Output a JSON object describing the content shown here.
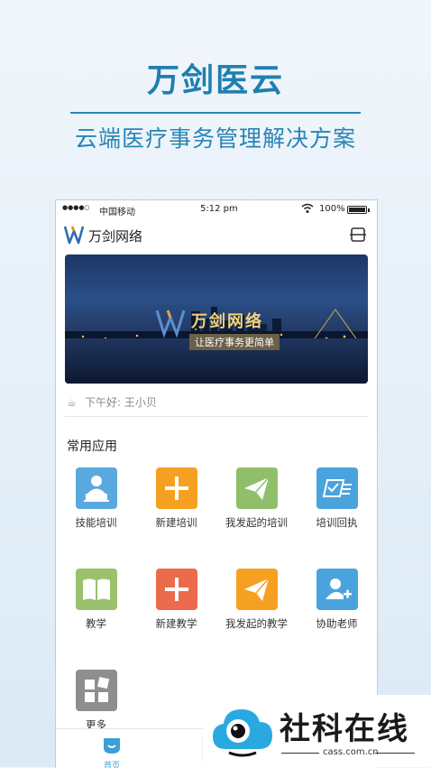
{
  "promo": {
    "title": "万剑医云",
    "subtitle": "云端医疗事务管理解决方案"
  },
  "status_bar": {
    "carrier": "中国移动",
    "time": "5:12 pm",
    "battery": "100%"
  },
  "app_bar": {
    "title": "万剑网络"
  },
  "banner": {
    "brand": "万剑网络",
    "slogan": "让医疗事务更简单"
  },
  "greeting": "下午好: 王小贝",
  "section_title": "常用应用",
  "apps": [
    {
      "label": "技能培训",
      "color": "#5aa9de",
      "icon": "lecture-icon"
    },
    {
      "label": "新建培训",
      "color": "#f6a021",
      "icon": "plus-icon"
    },
    {
      "label": "我发起的培训",
      "color": "#8fbf6a",
      "icon": "paper-plane-icon"
    },
    {
      "label": "培训回执",
      "color": "#4aa3dd",
      "icon": "receipt-icon"
    },
    {
      "label": "教学",
      "color": "#9bc06e",
      "icon": "book-icon"
    },
    {
      "label": "新建教学",
      "color": "#ec6b4c",
      "icon": "plus-icon"
    },
    {
      "label": "我发起的教学",
      "color": "#f6a021",
      "icon": "paper-plane-icon"
    },
    {
      "label": "协助老师",
      "color": "#4aa3dd",
      "icon": "add-user-icon"
    },
    {
      "label": "更多",
      "color": "#8e8e8e",
      "icon": "grid-icon"
    }
  ],
  "tabbar": {
    "home_label": "首页"
  },
  "watermark": {
    "text": "社科在线",
    "url": "cass.com.cn"
  }
}
